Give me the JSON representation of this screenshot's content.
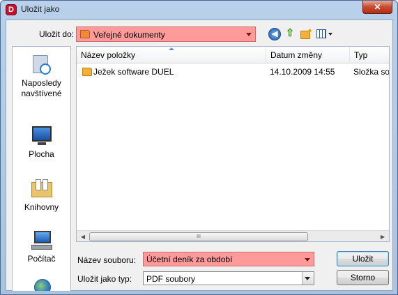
{
  "window": {
    "title": "Uložit jako",
    "app_icon_letter": "D",
    "close_glyph": "✕"
  },
  "toolbar": {
    "save_in_label": "Uložit do:",
    "save_in_value": "Veřejné dokumenty"
  },
  "places": [
    {
      "label": "Naposledy navštívené",
      "icon": "recent-places-icon"
    },
    {
      "label": "Plocha",
      "icon": "desktop-icon"
    },
    {
      "label": "Knihovny",
      "icon": "libraries-icon"
    },
    {
      "label": "Počítač",
      "icon": "computer-icon"
    },
    {
      "label": "",
      "icon": "network-icon"
    }
  ],
  "list": {
    "columns": [
      "Název položky",
      "Datum změny",
      "Typ"
    ],
    "rows": [
      {
        "name": "Ježek software DUEL",
        "date": "14.10.2009 14:55",
        "type": "Složka sou",
        "icon": "folder-icon"
      }
    ],
    "scroll_thumb_glyph": "III"
  },
  "form": {
    "file_name_label": "Název souboru:",
    "file_name_value": "Účetní deník za období",
    "file_type_label": "Uložit jako typ:",
    "file_type_value": "PDF soubory"
  },
  "buttons": {
    "save": "Uložit",
    "cancel": "Storno"
  },
  "colors": {
    "highlight_field": "#ff9a9a",
    "close_button": "#c74a2f"
  }
}
